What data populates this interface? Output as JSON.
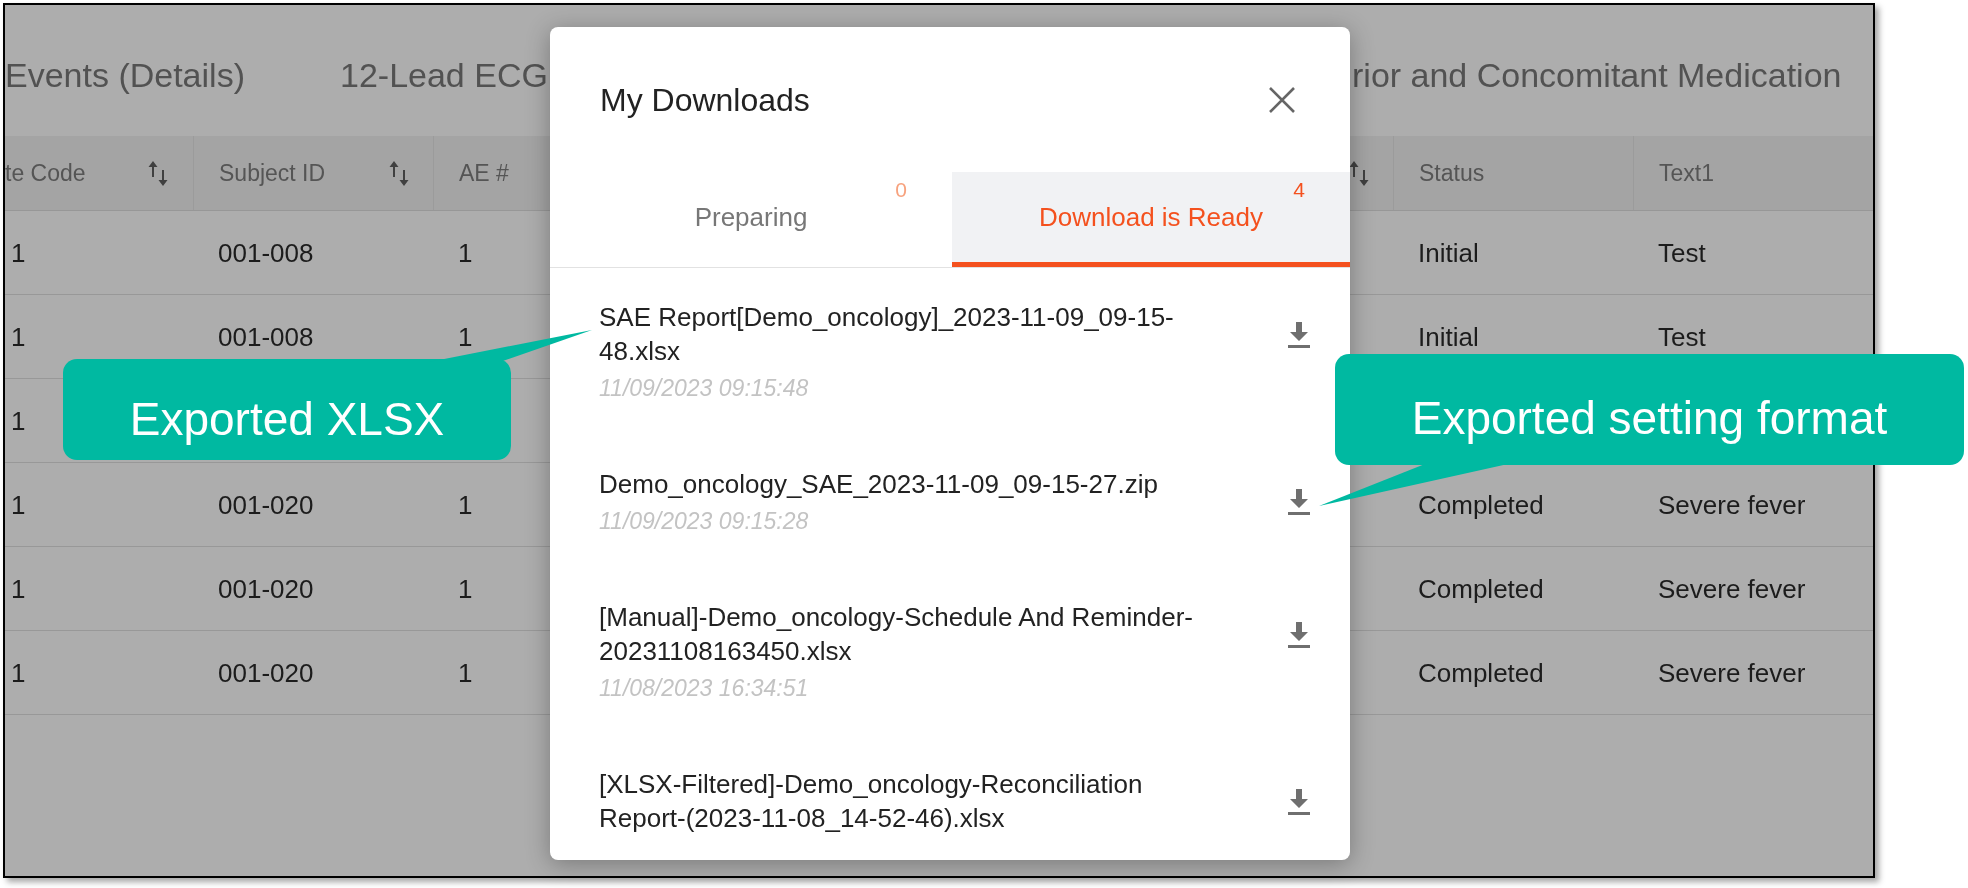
{
  "page_tabs": [
    {
      "label": "Events (Details)"
    },
    {
      "label": "12-Lead ECG"
    },
    {
      "label": "rior and Concomitant Medication"
    }
  ],
  "table": {
    "columns": [
      {
        "label": "te Code",
        "sortable": true
      },
      {
        "label": "Subject ID",
        "sortable": true
      },
      {
        "label": "AE #",
        "sortable": false
      },
      {
        "sortable": true
      },
      {
        "label": "Status",
        "sortable": false
      },
      {
        "label": "Text1",
        "sortable": false
      }
    ],
    "rows": [
      [
        "1",
        "001-008",
        "1",
        null,
        "Initial",
        "Test"
      ],
      [
        "1",
        "001-008",
        "1",
        null,
        "Initial",
        "Test"
      ],
      [
        "1",
        null,
        null,
        null,
        null,
        null
      ],
      [
        "1",
        "001-020",
        "1",
        null,
        "Completed",
        "Severe fever"
      ],
      [
        "1",
        "001-020",
        "1",
        null,
        "Completed",
        "Severe fever"
      ],
      [
        "1",
        "001-020",
        "1",
        null,
        "Completed",
        "Severe fever"
      ]
    ]
  },
  "dialog": {
    "title": "My Downloads",
    "tabs": [
      {
        "label": "Preparing",
        "count": "0",
        "selected": false
      },
      {
        "label": "Download is Ready",
        "count": "4",
        "selected": true
      }
    ],
    "files": [
      {
        "name": "SAE Report[Demo_oncology]_2023-11-09_09-15-48.xlsx",
        "date": "11/09/2023 09:15:48"
      },
      {
        "name": "Demo_oncology_SAE_2023-11-09_09-15-27.zip",
        "date": "11/09/2023 09:15:28"
      },
      {
        "name": "[Manual]-Demo_oncology-Schedule And Reminder-20231108163450.xlsx",
        "date": "11/08/2023 16:34:51"
      },
      {
        "name": "[XLSX-Filtered]-Demo_oncology-Reconciliation Report-(2023-11-08_14-52-46).xlsx"
      }
    ]
  },
  "callouts": [
    {
      "text": "Exported XLSX"
    },
    {
      "text": "Exported setting format"
    }
  ]
}
